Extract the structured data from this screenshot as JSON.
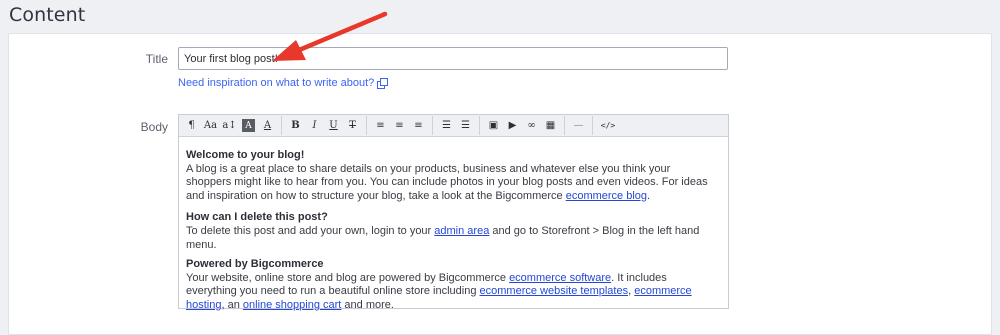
{
  "section": {
    "title": "Content"
  },
  "form": {
    "title_label": "Title",
    "title_value": "Your first blog post!",
    "inspiration_link": "Need inspiration on what to write about?",
    "body_label": "Body"
  },
  "toolbar": {
    "buttons": [
      "¶",
      "Aa",
      "a↕",
      "A",
      "A",
      "B",
      "I",
      "U",
      "T",
      "≡",
      "≡",
      "≡",
      "☰",
      "☰",
      "▣",
      "▶",
      "∞",
      "▦",
      "—",
      "</>"
    ]
  },
  "body": {
    "welcome_heading": "Welcome to your blog!",
    "welcome_text": "A blog is a great place to share details on your products, business and whatever else you think your shoppers might like to hear from you. You can include photos in your blog posts and even videos. For ideas and inspiration on how to structure your blog, take a look at the Bigcommerce ",
    "welcome_link": "ecommerce blog",
    "welcome_end": ".",
    "delete_heading": "How can I delete this post?",
    "delete_text_1": "To delete this post and add your own, login to your ",
    "delete_link": "admin area",
    "delete_text_2": " and go to Storefront > Blog in the left hand menu.",
    "powered_heading": "Powered by Bigcommerce",
    "powered_text_1": "Your website, online store and blog are powered by Bigcommerce ",
    "powered_link_1": "ecommerce software",
    "powered_text_2": ". It includes everything you need to run a beautiful online store including ",
    "powered_link_2": "ecommerce website templates",
    "powered_text_3": ", ",
    "powered_link_3": "ecommerce hosting",
    "powered_text_4": ", an ",
    "powered_link_4": "online shopping cart",
    "powered_text_5": " and more."
  },
  "colors": {
    "arrow": "#e8382b",
    "link": "#3c64f4"
  }
}
